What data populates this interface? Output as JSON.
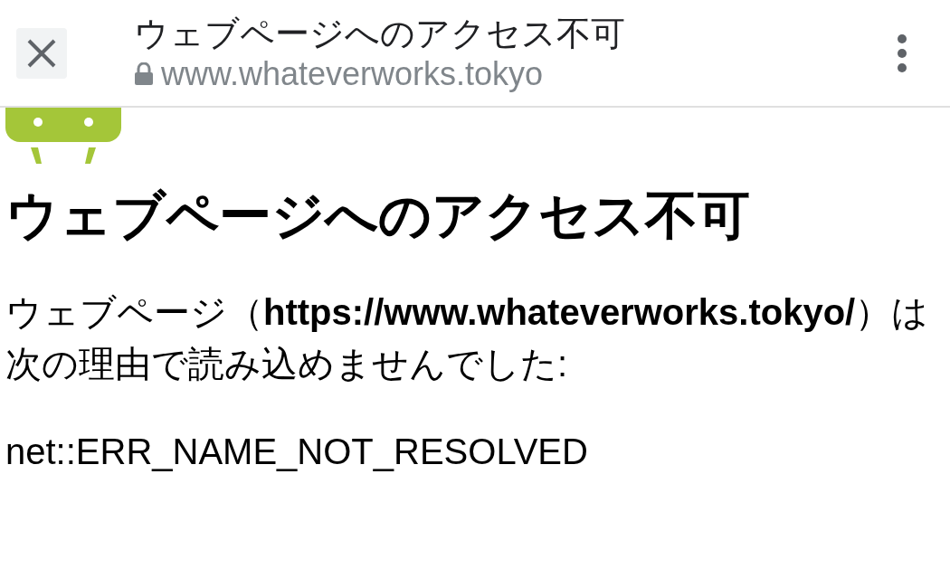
{
  "toolbar": {
    "title": "ウェブページへのアクセス不可",
    "url": "www.whateverworks.tokyo"
  },
  "page": {
    "heading": "ウェブページへのアクセス不可",
    "message": "ウェブページ（**https://www.whateverworks.tokyo/**）は次の理由で読み込めませんでした:",
    "error_code": "net::ERR_NAME_NOT_RESOLVED"
  }
}
